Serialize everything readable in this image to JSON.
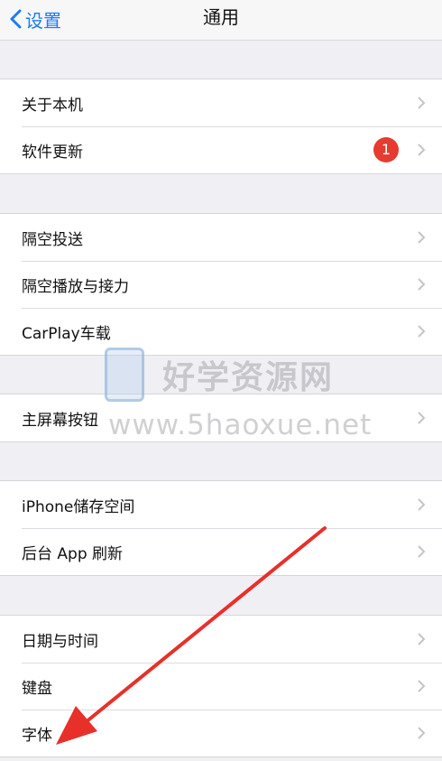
{
  "navbar": {
    "back_label": "设置",
    "title": "通用"
  },
  "groups": [
    {
      "rows": [
        {
          "label": "关于本机"
        },
        {
          "label": "软件更新",
          "badge": "1"
        }
      ]
    },
    {
      "rows": [
        {
          "label": "隔空投送"
        },
        {
          "label": "隔空播放与接力"
        },
        {
          "label": "CarPlay车载"
        }
      ]
    },
    {
      "rows": [
        {
          "label": "主屏幕按钮"
        }
      ]
    },
    {
      "rows": [
        {
          "label": "iPhone储存空间"
        },
        {
          "label": "后台 App 刷新"
        }
      ]
    },
    {
      "rows": [
        {
          "label": "日期与时间"
        },
        {
          "label": "键盘"
        },
        {
          "label": "字体"
        }
      ]
    }
  ],
  "watermark": {
    "title": "好学资源网",
    "url": "www.5haoxue.net"
  },
  "colors": {
    "accent": "#1a7cf5",
    "badge": "#e53b30",
    "annotation_arrow": "#e8302a"
  }
}
